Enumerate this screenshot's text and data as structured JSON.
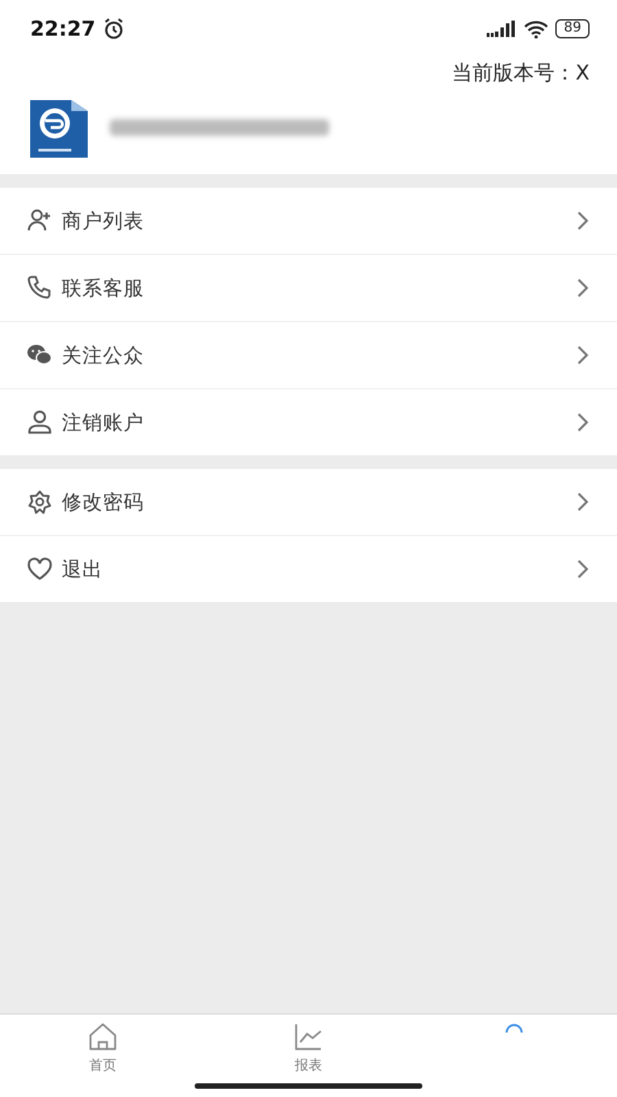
{
  "status_bar": {
    "time": "22:27",
    "battery": "89"
  },
  "version": {
    "label": "当前版本号：X"
  },
  "menu_groups": [
    {
      "items": [
        {
          "label": "商户列表"
        },
        {
          "label": "联系客服"
        },
        {
          "label": "关注公众"
        },
        {
          "label": "注销账户"
        }
      ]
    },
    {
      "items": [
        {
          "label": "修改密码"
        },
        {
          "label": "退出"
        }
      ]
    }
  ],
  "tabs": [
    {
      "label": "首页",
      "selected": false
    },
    {
      "label": "报表",
      "selected": false
    },
    {
      "selected": true
    }
  ]
}
